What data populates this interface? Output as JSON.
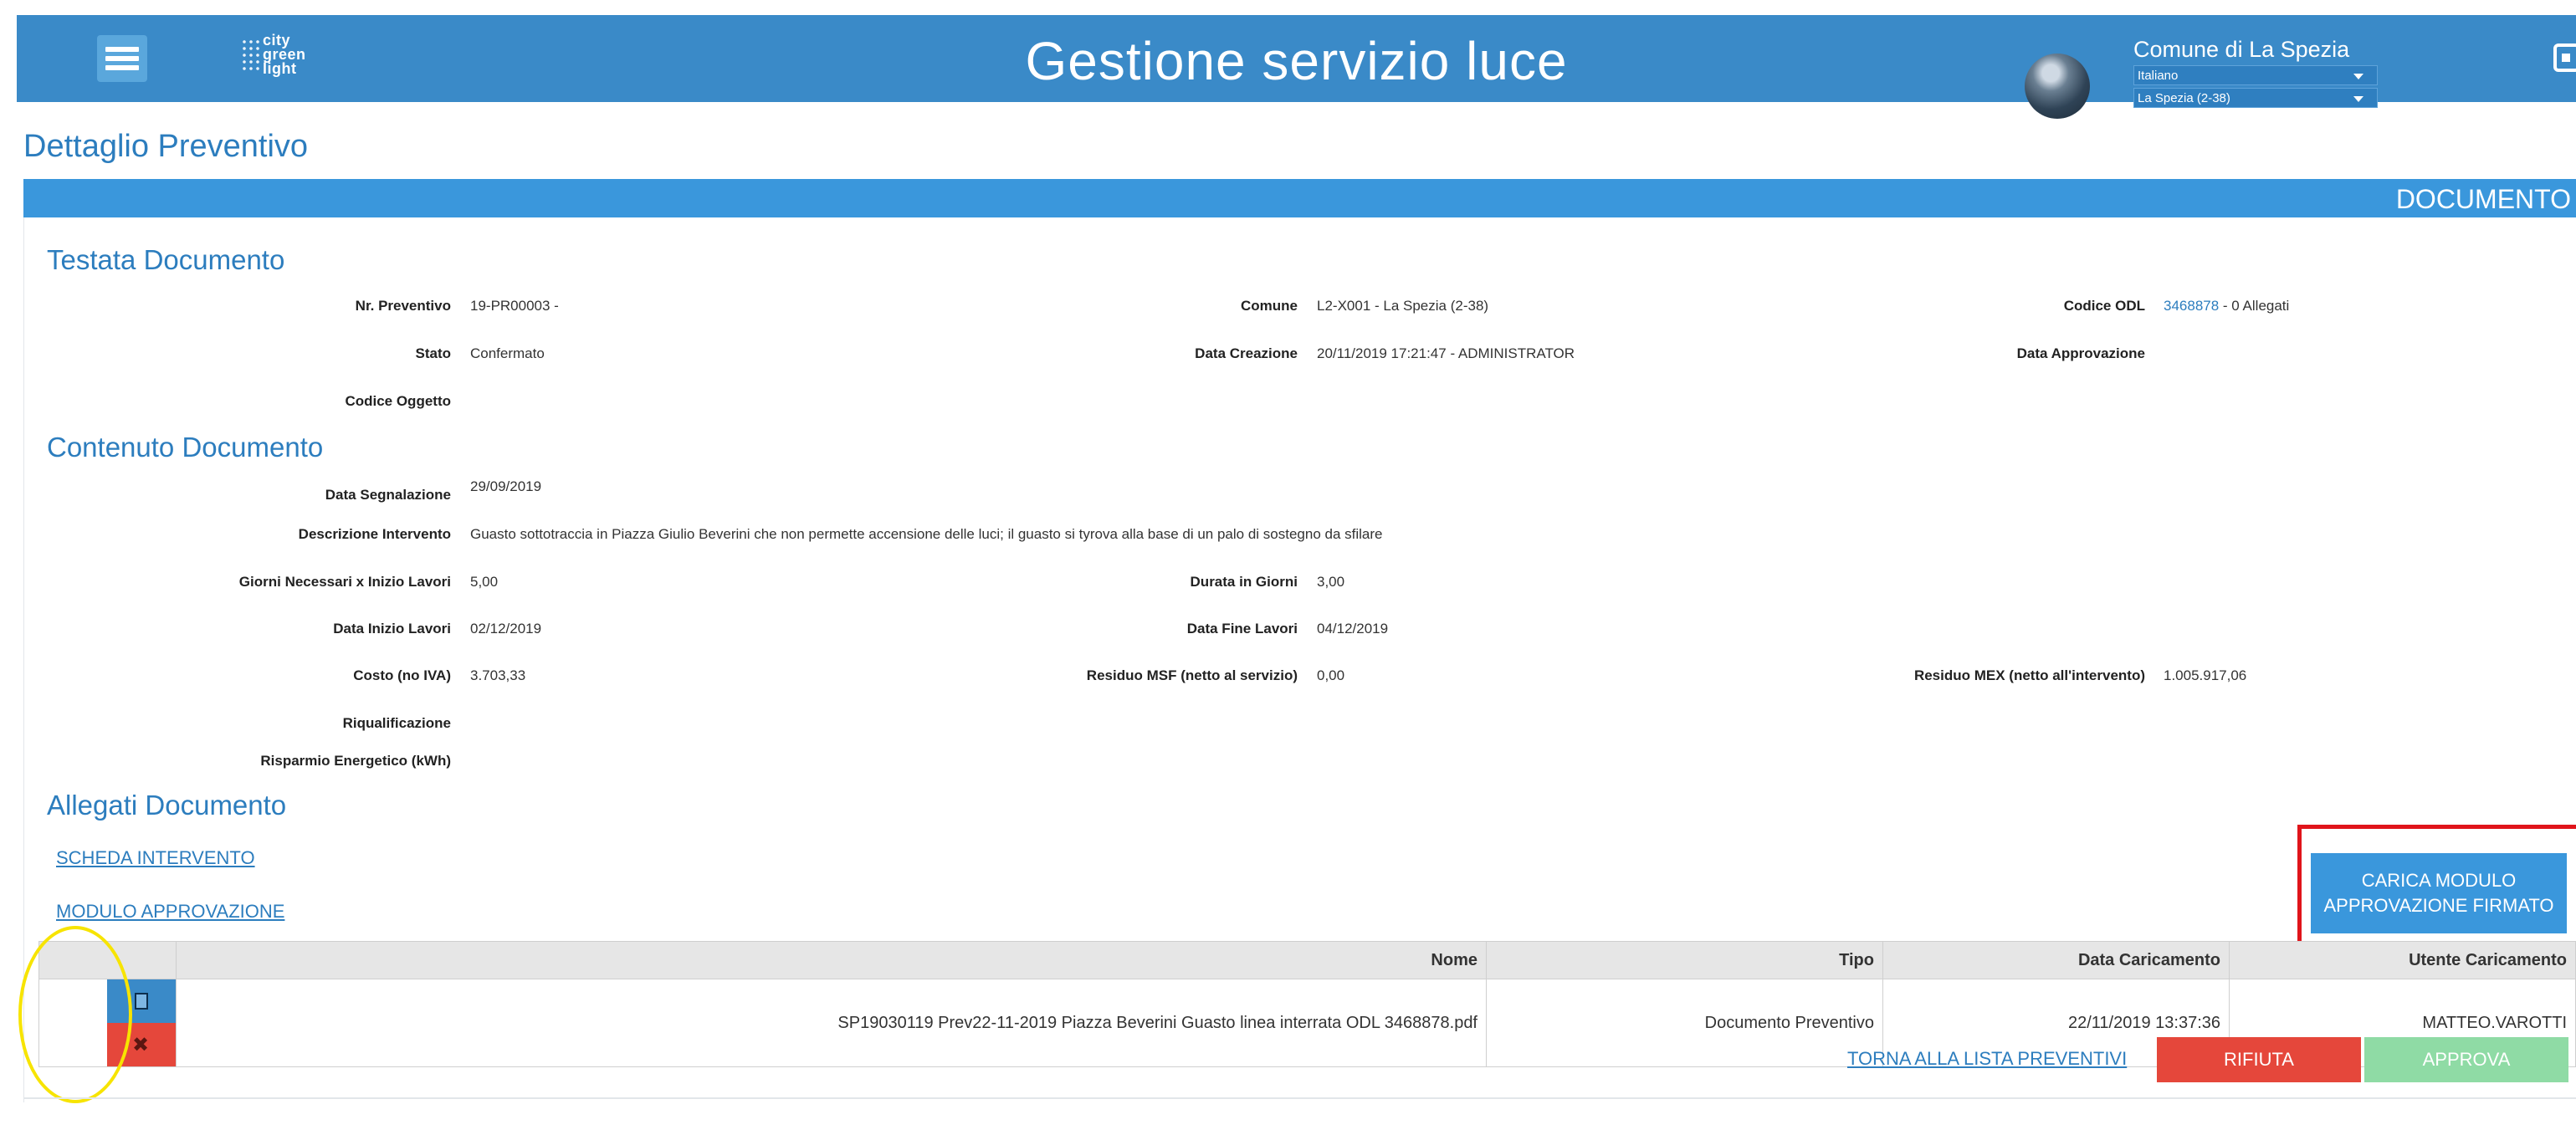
{
  "header": {
    "logo": "city green light",
    "title": "Gestione servizio luce",
    "comune": "Comune di La Spezia",
    "language": "Italiano",
    "location": "La Spezia (2-38)"
  },
  "page": {
    "title": "Dettaglio Preventivo",
    "bar_label": "DOCUMENTO"
  },
  "testata": {
    "title": "Testata Documento",
    "nr_preventivo": {
      "label": "Nr. Preventivo",
      "value": "19-PR00003 -"
    },
    "comune": {
      "label": "Comune",
      "value": "L2-X001 - La Spezia (2-38)"
    },
    "codice_odl": {
      "label": "Codice ODL",
      "link": "3468878",
      "suffix": "- 0 Allegati"
    },
    "stato": {
      "label": "Stato",
      "value": "Confermato"
    },
    "data_creazione": {
      "label": "Data Creazione",
      "value": "20/11/2019 17:21:47 - ADMINISTRATOR"
    },
    "data_approvazione": {
      "label": "Data Approvazione",
      "value": ""
    },
    "codice_oggetto": {
      "label": "Codice Oggetto",
      "value": ""
    }
  },
  "contenuto": {
    "title": "Contenuto Documento",
    "data_segnalazione": {
      "label": "Data Segnalazione",
      "value": "29/09/2019"
    },
    "descrizione": {
      "label": "Descrizione Intervento",
      "value": "Guasto sottotraccia in Piazza Giulio Beverini che non permette accensione delle luci; il guasto si tyrova alla base di un palo di sostegno da sfilare"
    },
    "giorni_necessari": {
      "label": "Giorni Necessari x Inizio Lavori",
      "value": "5,00"
    },
    "durata": {
      "label": "Durata in Giorni",
      "value": "3,00"
    },
    "data_inizio": {
      "label": "Data Inizio Lavori",
      "value": "02/12/2019"
    },
    "data_fine": {
      "label": "Data Fine Lavori",
      "value": "04/12/2019"
    },
    "costo": {
      "label": "Costo (no IVA)",
      "value": "3.703,33"
    },
    "residuo_msf": {
      "label": "Residuo MSF (netto al servizio)",
      "value": "0,00"
    },
    "residuo_mex": {
      "label": "Residuo MEX (netto all'intervento)",
      "value": "1.005.917,06"
    },
    "riqualificazione": {
      "label": "Riqualificazione",
      "value": ""
    },
    "risparmio": {
      "label": "Risparmio Energetico (kWh)",
      "value": ""
    }
  },
  "allegati": {
    "title": "Allegati Documento",
    "link_scheda": "SCHEDA INTERVENTO",
    "link_modulo": "MODULO APPROVAZIONE",
    "upload_button": "CARICA MODULO APPROVAZIONE FIRMATO",
    "columns": [
      "Nome",
      "Tipo",
      "Data Caricamento",
      "Utente Caricamento"
    ],
    "rows": [
      {
        "nome": "SP19030119 Prev22-11-2019 Piazza Beverini Guasto linea interrata ODL 3468878.pdf",
        "tipo": "Documento Preventivo",
        "data": "22/11/2019 13:37:36",
        "utente": "MATTEO.VAROTTI"
      }
    ]
  },
  "footer": {
    "back_link": "TORNA ALLA LISTA PREVENTIVI",
    "reject": "RIFIUTA",
    "approve": "APPROVA"
  },
  "colors": {
    "header_blue": "#3a8ac8",
    "accent_blue": "#2c7dbe",
    "bar_blue": "#3a97dc",
    "reject_red": "#e5473b",
    "approve_green": "#8fdba5",
    "highlight_red": "#e0141b",
    "highlight_yellow": "#f7e400"
  },
  "icons": [
    "menu-icon",
    "user-avatar",
    "logout-icon",
    "pdf-file-icon",
    "delete-icon",
    "chevron-down-icon"
  ]
}
